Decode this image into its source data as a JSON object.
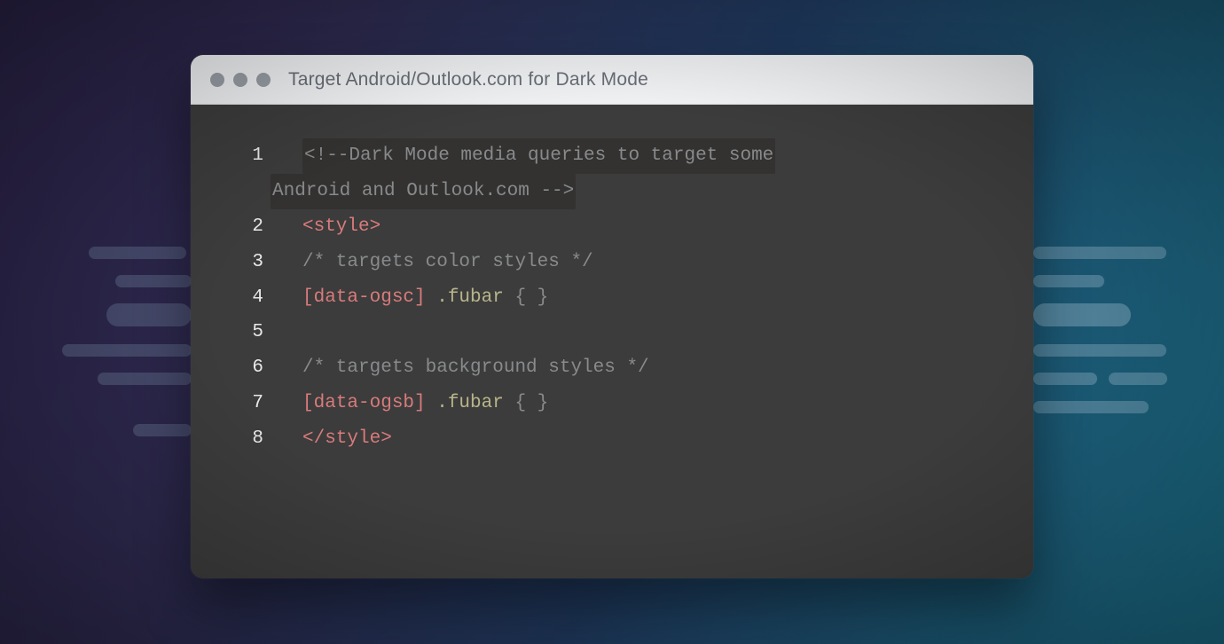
{
  "window": {
    "title": "Target Android/Outlook.com for Dark Mode"
  },
  "code": {
    "gutter": [
      "1",
      "2",
      "3",
      "4",
      "5",
      "6",
      "7",
      "8"
    ],
    "l1a": "<!--Dark Mode media queries to target some",
    "l1b": "Android and Outlook.com -->",
    "l2": "<style>",
    "l3": "/* targets color styles */",
    "l4_attr": "[data-ogsc]",
    "l4_sel": " .fubar ",
    "l4_braces": "{ }",
    "l6": "/* targets background styles */",
    "l7_attr": "[data-ogsb]",
    "l7_sel": " .fubar ",
    "l7_braces": "{ }",
    "l8": "</style>"
  }
}
